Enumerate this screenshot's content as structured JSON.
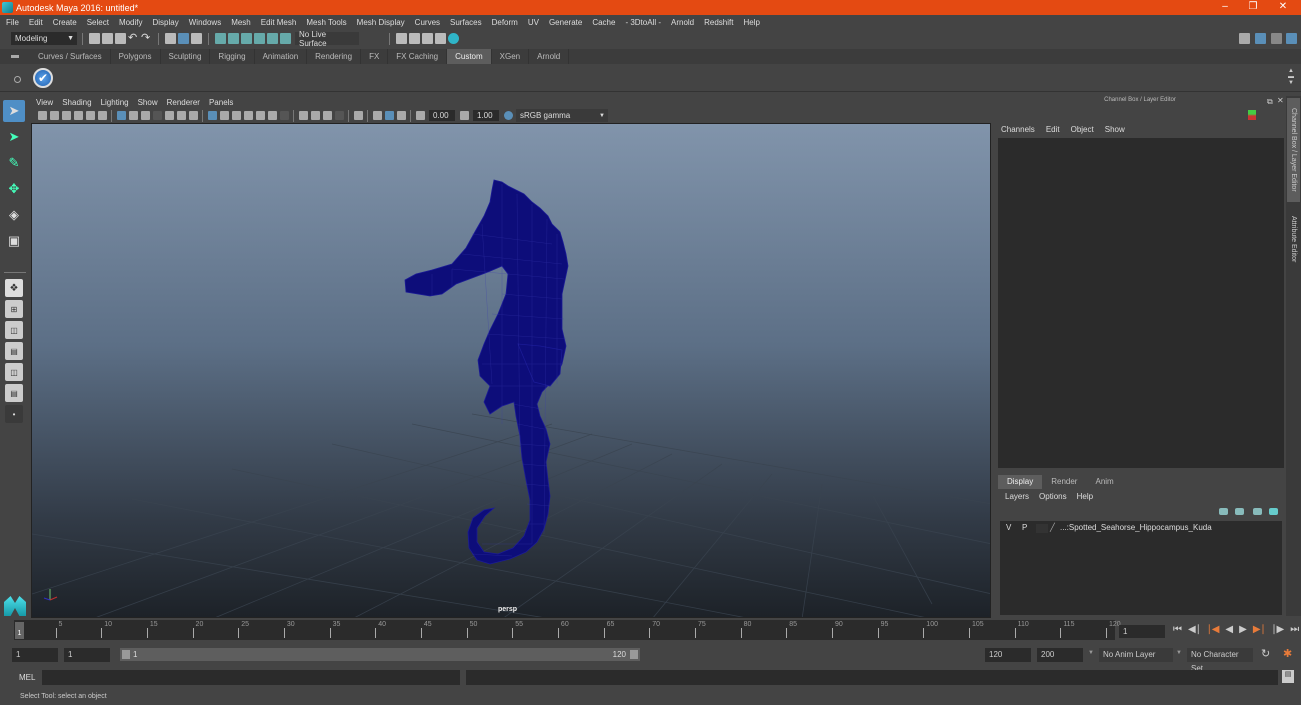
{
  "window": {
    "title": "Autodesk Maya 2016: untitled*",
    "controls": [
      "minimize",
      "restore",
      "close"
    ]
  },
  "menubar": [
    "File",
    "Edit",
    "Create",
    "Select",
    "Modify",
    "Display",
    "Windows",
    "Mesh",
    "Edit Mesh",
    "Mesh Tools",
    "Mesh Display",
    "Curves",
    "Surfaces",
    "Deform",
    "UV",
    "Generate",
    "Cache",
    "- 3DtoAll -",
    "Arnold",
    "Redshift",
    "Help"
  ],
  "toolbar": {
    "mode_selector": "Modeling",
    "live_surface": "No Live Surface"
  },
  "shelf": {
    "tabs": [
      "Curves / Surfaces",
      "Polygons",
      "Sculpting",
      "Rigging",
      "Animation",
      "Rendering",
      "FX",
      "FX Caching",
      "Custom",
      "XGen",
      "Arnold"
    ],
    "active_tab": "Custom"
  },
  "viewport": {
    "menu": [
      "View",
      "Shading",
      "Lighting",
      "Show",
      "Renderer",
      "Panels"
    ],
    "exposure": "0.00",
    "gamma": "1.00",
    "color_space": "sRGB gamma",
    "camera_label": "persp",
    "model_color": "#0d0d7a"
  },
  "channel_box": {
    "title": "Channel Box / Layer Editor",
    "menu": [
      "Channels",
      "Edit",
      "Object",
      "Show"
    ]
  },
  "layer_editor": {
    "tabs": [
      "Display",
      "Render",
      "Anim"
    ],
    "active_tab": "Display",
    "menu": [
      "Layers",
      "Options",
      "Help"
    ],
    "layers": [
      {
        "visible": "V",
        "playback": "P",
        "name": "...:Spotted_Seahorse_Hippocampus_Kuda"
      }
    ]
  },
  "side_tabs": [
    "Channel Box / Layer Editor",
    "Attribute Editor"
  ],
  "timeline": {
    "ticks": [
      "5",
      "10",
      "15",
      "20",
      "25",
      "30",
      "35",
      "40",
      "45",
      "50",
      "55",
      "60",
      "65",
      "70",
      "75",
      "80",
      "85",
      "90",
      "95",
      "100",
      "105",
      "110",
      "115",
      "120"
    ],
    "current_frame_marker": "1",
    "current_frame": "1"
  },
  "range": {
    "start": "1",
    "playback_start": "1",
    "slider_start": "1",
    "slider_end": "120",
    "playback_end": "120",
    "end": "200",
    "anim_layer": "No Anim Layer",
    "character_set": "No Character Set"
  },
  "command_line": {
    "label": "MEL"
  },
  "status": {
    "help_text": "Select Tool: select an object"
  }
}
